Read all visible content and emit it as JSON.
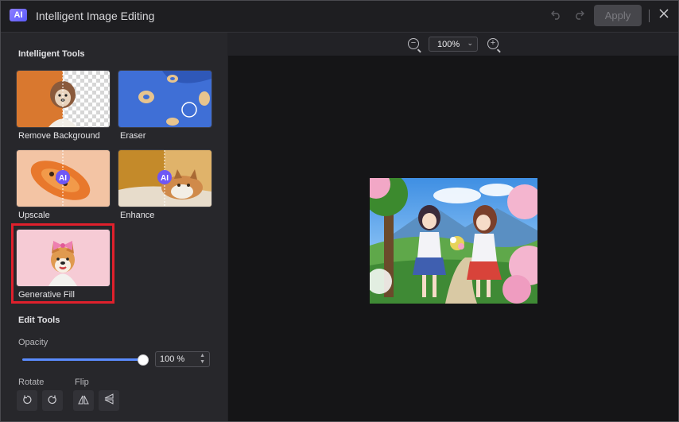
{
  "app": {
    "badge": "AI",
    "title": "Intelligent Image Editing",
    "apply_label": "Apply"
  },
  "intelligent_tools": {
    "title": "Intelligent Tools",
    "tools": [
      {
        "label": "Remove Background"
      },
      {
        "label": "Eraser"
      },
      {
        "label": "Upscale"
      },
      {
        "label": "Enhance"
      },
      {
        "label": "Generative Fill"
      }
    ]
  },
  "edit_tools": {
    "title": "Edit Tools",
    "opacity_label": "Opacity",
    "opacity_value": "100 %",
    "opacity_level": 1.0,
    "rotate_label": "Rotate",
    "flip_label": "Flip"
  },
  "canvas": {
    "zoom_value": "100%"
  },
  "icons": {
    "undo": "undo-icon",
    "redo": "redo-icon",
    "close": "close-icon",
    "zoom_out": "zoom-out-icon",
    "zoom_in": "zoom-in-icon"
  },
  "colors": {
    "accent": "#5b8cff",
    "highlight": "#e0202c"
  }
}
